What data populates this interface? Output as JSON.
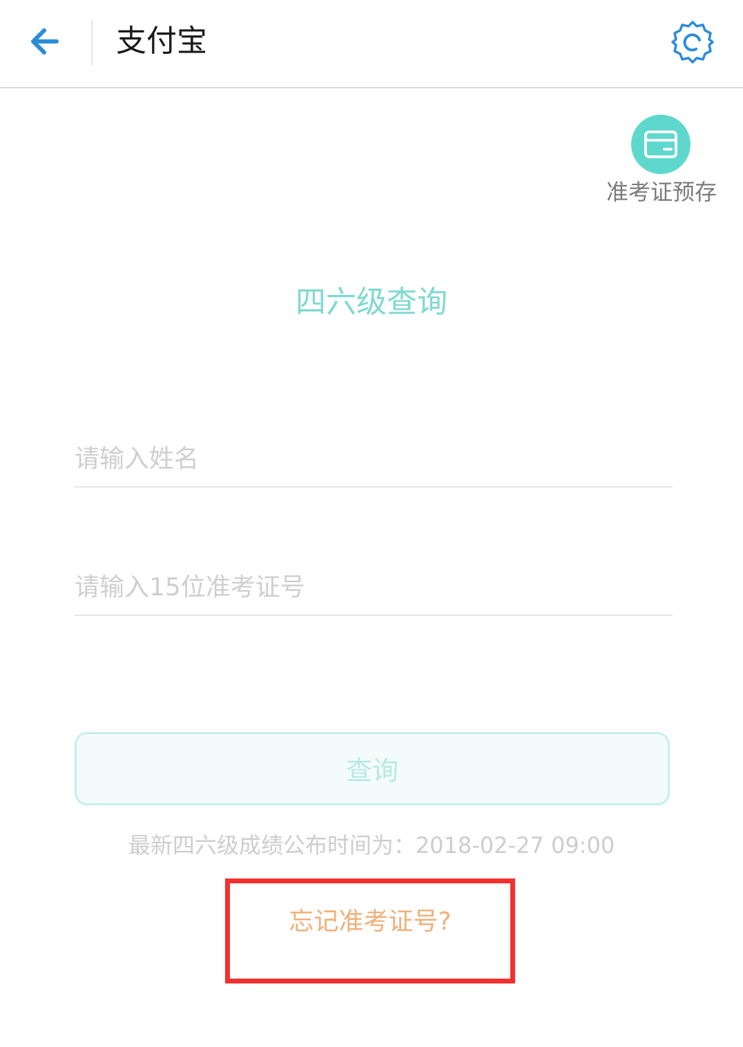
{
  "header": {
    "title": "支付宝",
    "back_icon": "back-arrow-icon",
    "settings_icon": "settings-gear-icon",
    "accent_color": "#2d8cd8"
  },
  "prestore": {
    "label": "准考证预存",
    "icon": "card-icon",
    "color": "#5ed8cd"
  },
  "main": {
    "heading": "四六级查询",
    "name_placeholder": "请输入姓名",
    "name_value": "",
    "ticket_placeholder": "请输入15位准考证号",
    "ticket_value": "",
    "query_label": "查询",
    "release_info": "最新四六级成绩公布时间为：2018-02-27 09:00",
    "forgot_link": "忘记准考证号?",
    "highlight_color": "#f2302e"
  }
}
